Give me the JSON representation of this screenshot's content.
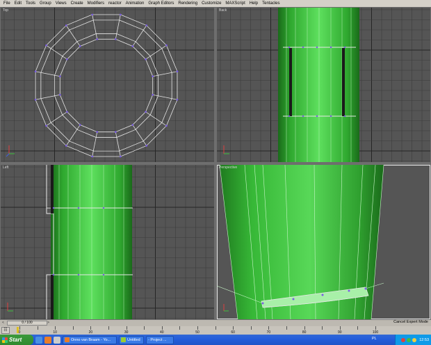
{
  "menubar": {
    "items": [
      "File",
      "Edit",
      "Tools",
      "Group",
      "Views",
      "Create",
      "Modifiers",
      "reactor",
      "Animation",
      "Graph Editors",
      "Rendering",
      "Customize",
      "MAXScript",
      "Help",
      "Tentacles"
    ]
  },
  "viewports": {
    "top": {
      "label": "Top"
    },
    "back": {
      "label": "Back"
    },
    "left": {
      "label": "Left"
    },
    "perspective": {
      "label": "Perspective"
    }
  },
  "timeline": {
    "slider_text": "0 / 100",
    "prev_symbol": "<",
    "next_symbol": ">",
    "ticks": [
      "0",
      "5",
      "10",
      "15",
      "20",
      "25",
      "30",
      "35",
      "40",
      "45",
      "50",
      "55",
      "60",
      "65",
      "70",
      "75",
      "80",
      "85",
      "90",
      "95",
      "100"
    ],
    "cancel_expert_mode": "Cancel Expert Mode"
  },
  "taskbar": {
    "start_label": "start",
    "tasks": [
      "Onno van Braam - Yo...",
      "Untitled",
      "- Project ..."
    ],
    "language": "PL",
    "clock": "12:53"
  },
  "colors": {
    "viewport_bg": "#555555",
    "grid": "#3c3c3c",
    "grid_major": "#252525",
    "mesh_green": "#3cc83c",
    "wire": "#e6e6e6",
    "vertex": "#7a5ce6"
  }
}
